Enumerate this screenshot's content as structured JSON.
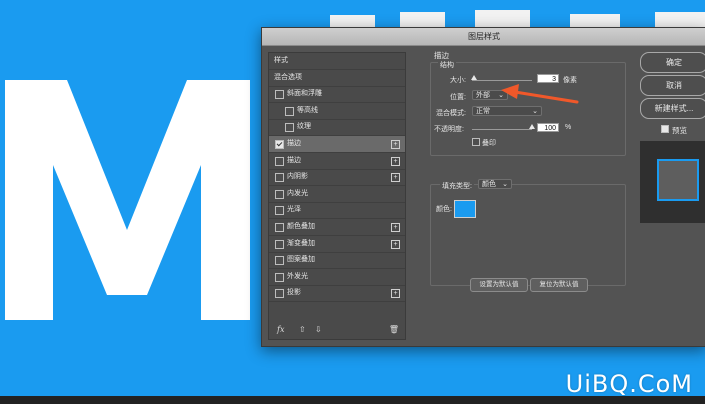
{
  "dialog": {
    "title": "图层样式"
  },
  "left_panel": {
    "items": [
      {
        "label": "样式",
        "checkbox": false,
        "checked": false,
        "plus": false,
        "selected": false,
        "indent": 0
      },
      {
        "label": "混合选项",
        "checkbox": false,
        "checked": false,
        "plus": false,
        "selected": false,
        "indent": 0
      },
      {
        "label": "斜面和浮雕",
        "checkbox": true,
        "checked": false,
        "plus": false,
        "selected": false,
        "indent": 0
      },
      {
        "label": "等高线",
        "checkbox": true,
        "checked": false,
        "plus": false,
        "selected": false,
        "indent": 1
      },
      {
        "label": "纹理",
        "checkbox": true,
        "checked": false,
        "plus": false,
        "selected": false,
        "indent": 1
      },
      {
        "label": "描边",
        "checkbox": true,
        "checked": true,
        "plus": true,
        "selected": true,
        "indent": 0
      },
      {
        "label": "描边",
        "checkbox": true,
        "checked": false,
        "plus": true,
        "selected": false,
        "indent": 0
      },
      {
        "label": "内阴影",
        "checkbox": true,
        "checked": false,
        "plus": true,
        "selected": false,
        "indent": 0
      },
      {
        "label": "内发光",
        "checkbox": true,
        "checked": false,
        "plus": false,
        "selected": false,
        "indent": 0
      },
      {
        "label": "光泽",
        "checkbox": true,
        "checked": false,
        "plus": false,
        "selected": false,
        "indent": 0
      },
      {
        "label": "颜色叠加",
        "checkbox": true,
        "checked": false,
        "plus": true,
        "selected": false,
        "indent": 0
      },
      {
        "label": "渐变叠加",
        "checkbox": true,
        "checked": false,
        "plus": true,
        "selected": false,
        "indent": 0
      },
      {
        "label": "图案叠加",
        "checkbox": true,
        "checked": false,
        "plus": false,
        "selected": false,
        "indent": 0
      },
      {
        "label": "外发光",
        "checkbox": true,
        "checked": false,
        "plus": false,
        "selected": false,
        "indent": 0
      },
      {
        "label": "投影",
        "checkbox": true,
        "checked": false,
        "plus": true,
        "selected": false,
        "indent": 0
      }
    ],
    "footer": {
      "fx_label": "fx",
      "up_icon": "arrow-up-icon",
      "down_icon": "arrow-down-icon",
      "trash_icon": "trash-icon"
    }
  },
  "stroke": {
    "section_title": "描边",
    "structure_title": "结构",
    "size_label": "大小:",
    "size_value": "3",
    "size_unit": "像素",
    "size_slider_fraction": 0.03,
    "position_label": "位置:",
    "position_value": "外部",
    "blend_label": "混合模式:",
    "blend_value": "正常",
    "opacity_label": "不透明度:",
    "opacity_value": "100",
    "opacity_unit": "%",
    "opacity_slider_fraction": 1.0,
    "overprint_label": "叠印",
    "fill_type_label": "填充类型:",
    "fill_type_value": "颜色",
    "color_label": "颜色:",
    "color_hex": "#1a9bf0",
    "set_default_button": "设置为默认值",
    "reset_default_button": "复位为默认值"
  },
  "right": {
    "ok_button": "确定",
    "cancel_button": "取消",
    "new_style_button": "新建样式...",
    "preview_label": "预览",
    "preview_checked": true
  },
  "watermark": "UiBQ.CoM",
  "colors": {
    "canvas_bg": "#1a9bf0",
    "dialog_bg": "#535353",
    "arrow": "#f0582a"
  }
}
